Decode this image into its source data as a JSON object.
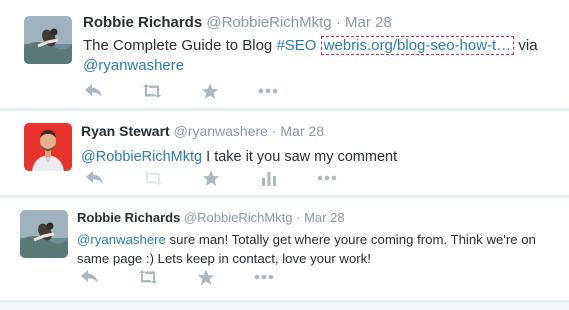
{
  "tweets": [
    {
      "fullname": "Robbie Richards",
      "username": "@RobbieRichMktg",
      "separator": "·",
      "time": "Mar 28",
      "text_before": "The Complete Guide to Blog ",
      "hashtag": "#SEO",
      "link": "webris.org/blog-seo-how-t…",
      "text_after": " via",
      "mention": "@ryanwashere"
    },
    {
      "fullname": "Ryan Stewart",
      "username": "@ryanwashere",
      "separator": "·",
      "time": "Mar 28",
      "mention": "@RobbieRichMktg",
      "text_after": " I take it you saw my comment"
    },
    {
      "fullname": "Robbie Richards",
      "username": "@RobbieRichMktg",
      "separator": "·",
      "time": "Mar 28",
      "mention": "@ryanwashere",
      "text_line1": " sure man! Totally get where youre coming from. Think we're on",
      "text_line2": "same page :) Lets keep in contact, love your work!"
    }
  ],
  "action_icons": [
    "reply-icon",
    "retweet-icon",
    "favorite-icon",
    "more-icon",
    "analytics-icon"
  ],
  "colors": {
    "link": "#2b7bb9",
    "icon": "#aab8c2",
    "muted": "#8899a6",
    "text": "#292f33",
    "highlight": "#e0245e"
  }
}
